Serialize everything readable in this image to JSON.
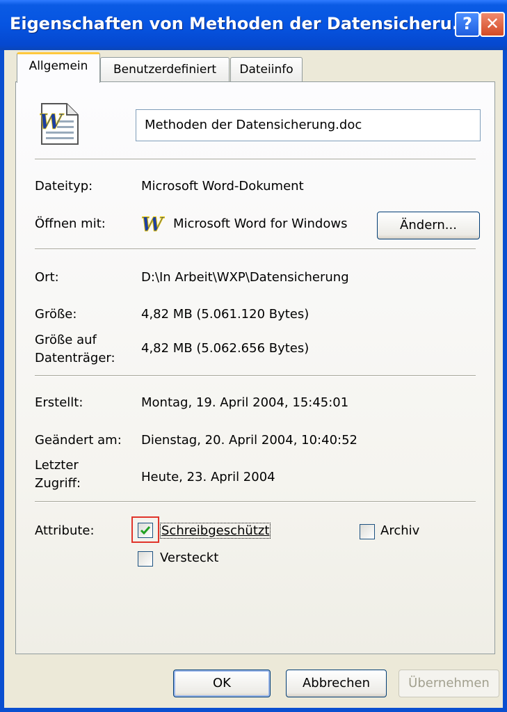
{
  "window": {
    "title": "Eigenschaften von Methoden der Datensicheru...",
    "help_glyph": "?",
    "close_glyph": "✕"
  },
  "tabs": [
    {
      "label": "Allgemein",
      "active": true
    },
    {
      "label": "Benutzerdefiniert",
      "active": false
    },
    {
      "label": "Dateiinfo",
      "active": false
    }
  ],
  "file": {
    "icon": "word-document-icon",
    "name": "Methoden der Datensicherung.doc"
  },
  "fields": {
    "type_label": "Dateityp:",
    "type_value": "Microsoft Word-Dokument",
    "open_with_label": "Öffnen mit:",
    "open_with_icon": "word-app-icon",
    "open_with_value": "Microsoft Word for Windows",
    "change_button": "Ändern...",
    "location_label": "Ort:",
    "location_value": "D:\\In Arbeit\\WXP\\Datensicherung",
    "size_label": "Größe:",
    "size_value": "4,82 MB (5.061.120 Bytes)",
    "size_on_disk_label_1": "Größe auf",
    "size_on_disk_label_2": "Datenträger:",
    "size_on_disk_value": "4,82 MB (5.062.656 Bytes)",
    "created_label": "Erstellt:",
    "created_value": "Montag, 19. April 2004, 15:45:01",
    "modified_label": "Geändert am:",
    "modified_value": "Dienstag, 20. April 2004, 10:40:52",
    "accessed_label_1": "Letzter",
    "accessed_label_2": "Zugriff:",
    "accessed_value": "Heute, 23. April 2004"
  },
  "attributes": {
    "label": "Attribute:",
    "readonly": {
      "label": "Schreibgeschützt",
      "checked": true
    },
    "hidden": {
      "label": "Versteckt",
      "checked": false
    },
    "archive": {
      "label": "Archiv",
      "checked": false
    }
  },
  "buttons": {
    "ok": "OK",
    "cancel": "Abbrechen",
    "apply": "Übernehmen"
  },
  "colors": {
    "titlebar": "#0654e1",
    "dialog_bg": "#ece9d8",
    "focus_highlight": "#e0342a",
    "check_green": "#21a121"
  }
}
